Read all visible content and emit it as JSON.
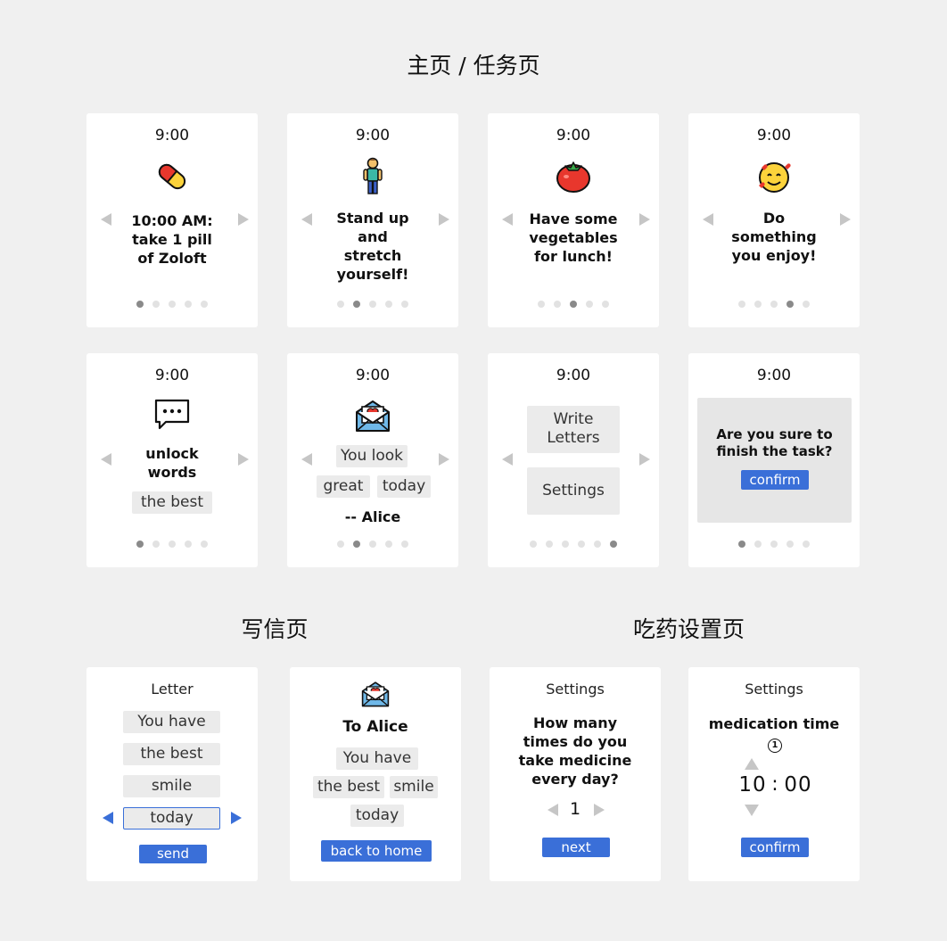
{
  "sections": {
    "main": "主页 / 任务页",
    "letter": "写信页",
    "med": "吃药设置页"
  },
  "time": "9:00",
  "task_cards": [
    {
      "icon": "pill-icon",
      "text_lines": [
        "10:00 AM:",
        "take 1 pill",
        "of Zoloft"
      ],
      "active_dot": 0
    },
    {
      "icon": "person-standing-icon",
      "text_lines": [
        "Stand up",
        "and",
        "stretch",
        "yourself!"
      ],
      "active_dot": 1
    },
    {
      "icon": "tomato-icon",
      "text_lines": [
        "Have some",
        "vegetables",
        "for lunch!"
      ],
      "active_dot": 2
    },
    {
      "icon": "smiling-face-with-hearts-icon",
      "text_lines": [
        "Do",
        "something",
        "you enjoy!"
      ],
      "active_dot": 3
    }
  ],
  "unlock_card": {
    "icon": "speech-bubble-icon",
    "text_lines": [
      "unlock",
      "words"
    ],
    "chip": "the best"
  },
  "alice_card": {
    "icon": "love-letter-icon",
    "chips": [
      "You look",
      "great",
      "today"
    ],
    "signature": "-- Alice"
  },
  "menu_card": {
    "write_lines": [
      "Write",
      "Letters"
    ],
    "settings": "Settings"
  },
  "confirm_card": {
    "question_lines": [
      "Are you sure to",
      "finish the task?"
    ],
    "confirm": "confirm"
  },
  "letter_card": {
    "title": "Letter",
    "chips": [
      "You have",
      "the best",
      "smile",
      "today"
    ],
    "send": "send"
  },
  "to_alice_card": {
    "icon": "love-letter-icon",
    "title": "To Alice",
    "chips": [
      "You have",
      "the best",
      "smile",
      "today"
    ],
    "back": "back to home"
  },
  "settings_count_card": {
    "title": "Settings",
    "question_lines": [
      "How many",
      "times do you",
      "take medicine",
      "every day?"
    ],
    "value": "1",
    "next": "next"
  },
  "settings_time_card": {
    "title": "Settings",
    "label": "medication time",
    "index": "1",
    "hour": "10",
    "sep": ":",
    "minute": "00",
    "confirm": "confirm"
  }
}
